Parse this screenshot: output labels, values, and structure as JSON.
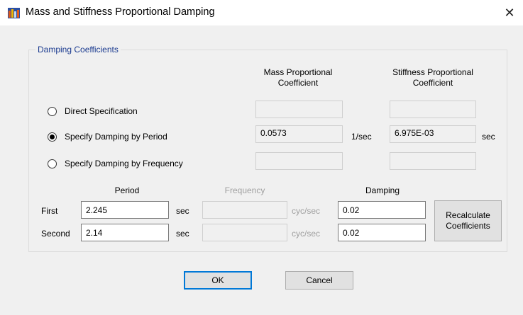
{
  "window": {
    "title": "Mass and Stiffness Proportional Damping",
    "close_glyph": "✕",
    "icon": "app-logo-icon"
  },
  "group": {
    "legend": "Damping Coefficients",
    "col_mass": "Mass Proportional Coefficient",
    "col_mass_line1": "Mass Proportional",
    "col_mass_line2": "Coefficient",
    "col_stiff_line1": "Stiffness Proportional",
    "col_stiff_line2": "Coefficient"
  },
  "options": [
    {
      "label": "Direct Specification",
      "selected": false,
      "mass": "",
      "mass_unit": "",
      "stiff": "",
      "stiff_unit": ""
    },
    {
      "label": "Specify Damping by Period",
      "selected": true,
      "mass": "0.0573",
      "mass_unit": "1/sec",
      "stiff": "6.975E-03",
      "stiff_unit": "sec"
    },
    {
      "label": "Specify Damping by Frequency",
      "selected": false,
      "mass": "",
      "mass_unit": "",
      "stiff": "",
      "stiff_unit": ""
    }
  ],
  "table": {
    "period_header": "Period",
    "frequency_header": "Frequency",
    "damping_header": "Damping",
    "rows": [
      {
        "label": "First",
        "period": "2.245",
        "period_unit": "sec",
        "frequency": "",
        "frequency_unit": "cyc/sec",
        "damping": "0.02"
      },
      {
        "label": "Second",
        "period": "2.14",
        "period_unit": "sec",
        "frequency": "",
        "frequency_unit": "cyc/sec",
        "damping": "0.02"
      }
    ],
    "recalc_line1": "Recalculate",
    "recalc_line2": "Coefficients"
  },
  "buttons": {
    "ok": "OK",
    "cancel": "Cancel"
  }
}
